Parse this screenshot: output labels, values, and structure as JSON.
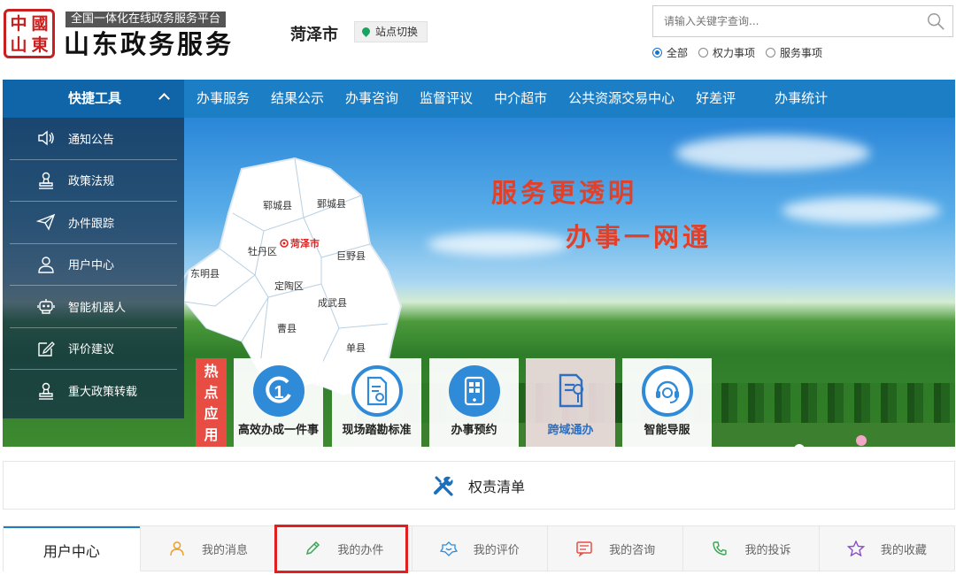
{
  "header": {
    "seal_chars": [
      "中",
      "國",
      "山",
      "東"
    ],
    "tagline": "全国一体化在线政务服务平台",
    "brand": "山东政务服务",
    "city": "菏泽市",
    "switch_label": "站点切换",
    "search_placeholder": "请输入关键字查询...",
    "scope_options": [
      "全部",
      "权力事项",
      "服务事项"
    ],
    "scope_selected": "全部"
  },
  "nav": {
    "quick_tools": "快捷工具",
    "items": [
      "办事服务",
      "结果公示",
      "办事咨询",
      "监督评议",
      "中介超市",
      "公共资源交易中心",
      "好差评",
      "办事统计"
    ]
  },
  "sidemenu": {
    "items": [
      {
        "label": "通知公告",
        "icon": "speaker-icon"
      },
      {
        "label": "政策法规",
        "icon": "stamp-icon"
      },
      {
        "label": "办件跟踪",
        "icon": "paper-plane-icon"
      },
      {
        "label": "用户中心",
        "icon": "user-icon"
      },
      {
        "label": "智能机器人",
        "icon": "robot-icon"
      },
      {
        "label": "评价建议",
        "icon": "edit-icon"
      },
      {
        "label": "重大政策转载",
        "icon": "stamp-icon"
      }
    ]
  },
  "banner": {
    "slogan1": "服务更透明",
    "slogan2": "办事一网通",
    "map": {
      "capital": "菏泽市",
      "districts": [
        "郓城县",
        "鄄城县",
        "牡丹区",
        "巨野县",
        "东明县",
        "定陶区",
        "成武县",
        "曹县",
        "单县"
      ]
    }
  },
  "hot_apps": {
    "label": "热点应用",
    "cards": [
      {
        "label": "高效办成一件事",
        "icon": "one-stop-icon"
      },
      {
        "label": "现场踏勘标准",
        "icon": "document-seal-icon"
      },
      {
        "label": "办事预约",
        "icon": "tablet-icon"
      },
      {
        "label": "跨域通办",
        "icon": "document-location-icon"
      },
      {
        "label": "智能导服",
        "icon": "headset-icon"
      }
    ]
  },
  "rights_list": {
    "label": "权责清单",
    "icon": "tools-icon"
  },
  "user_center": {
    "title": "用户中心",
    "tabs": [
      {
        "label": "我的消息",
        "icon": "user-outline-icon",
        "color": "#f0a020"
      },
      {
        "label": "我的办件",
        "icon": "pencil-icon",
        "color": "#3aa655"
      },
      {
        "label": "我的评价",
        "icon": "badge-icon",
        "color": "#2f8bd8"
      },
      {
        "label": "我的咨询",
        "icon": "message-icon",
        "color": "#e84d44"
      },
      {
        "label": "我的投诉",
        "icon": "phone-icon",
        "color": "#3aa655"
      },
      {
        "label": "我的收藏",
        "icon": "star-icon",
        "color": "#8a4cc9"
      }
    ],
    "highlighted": "我的办件"
  },
  "colors": {
    "nav_blue": "#1c7fc6",
    "nav_dark": "#0f65a8",
    "hot_red": "#e84d44",
    "slogan_red": "#e0412a",
    "highlight": "#e02020"
  }
}
